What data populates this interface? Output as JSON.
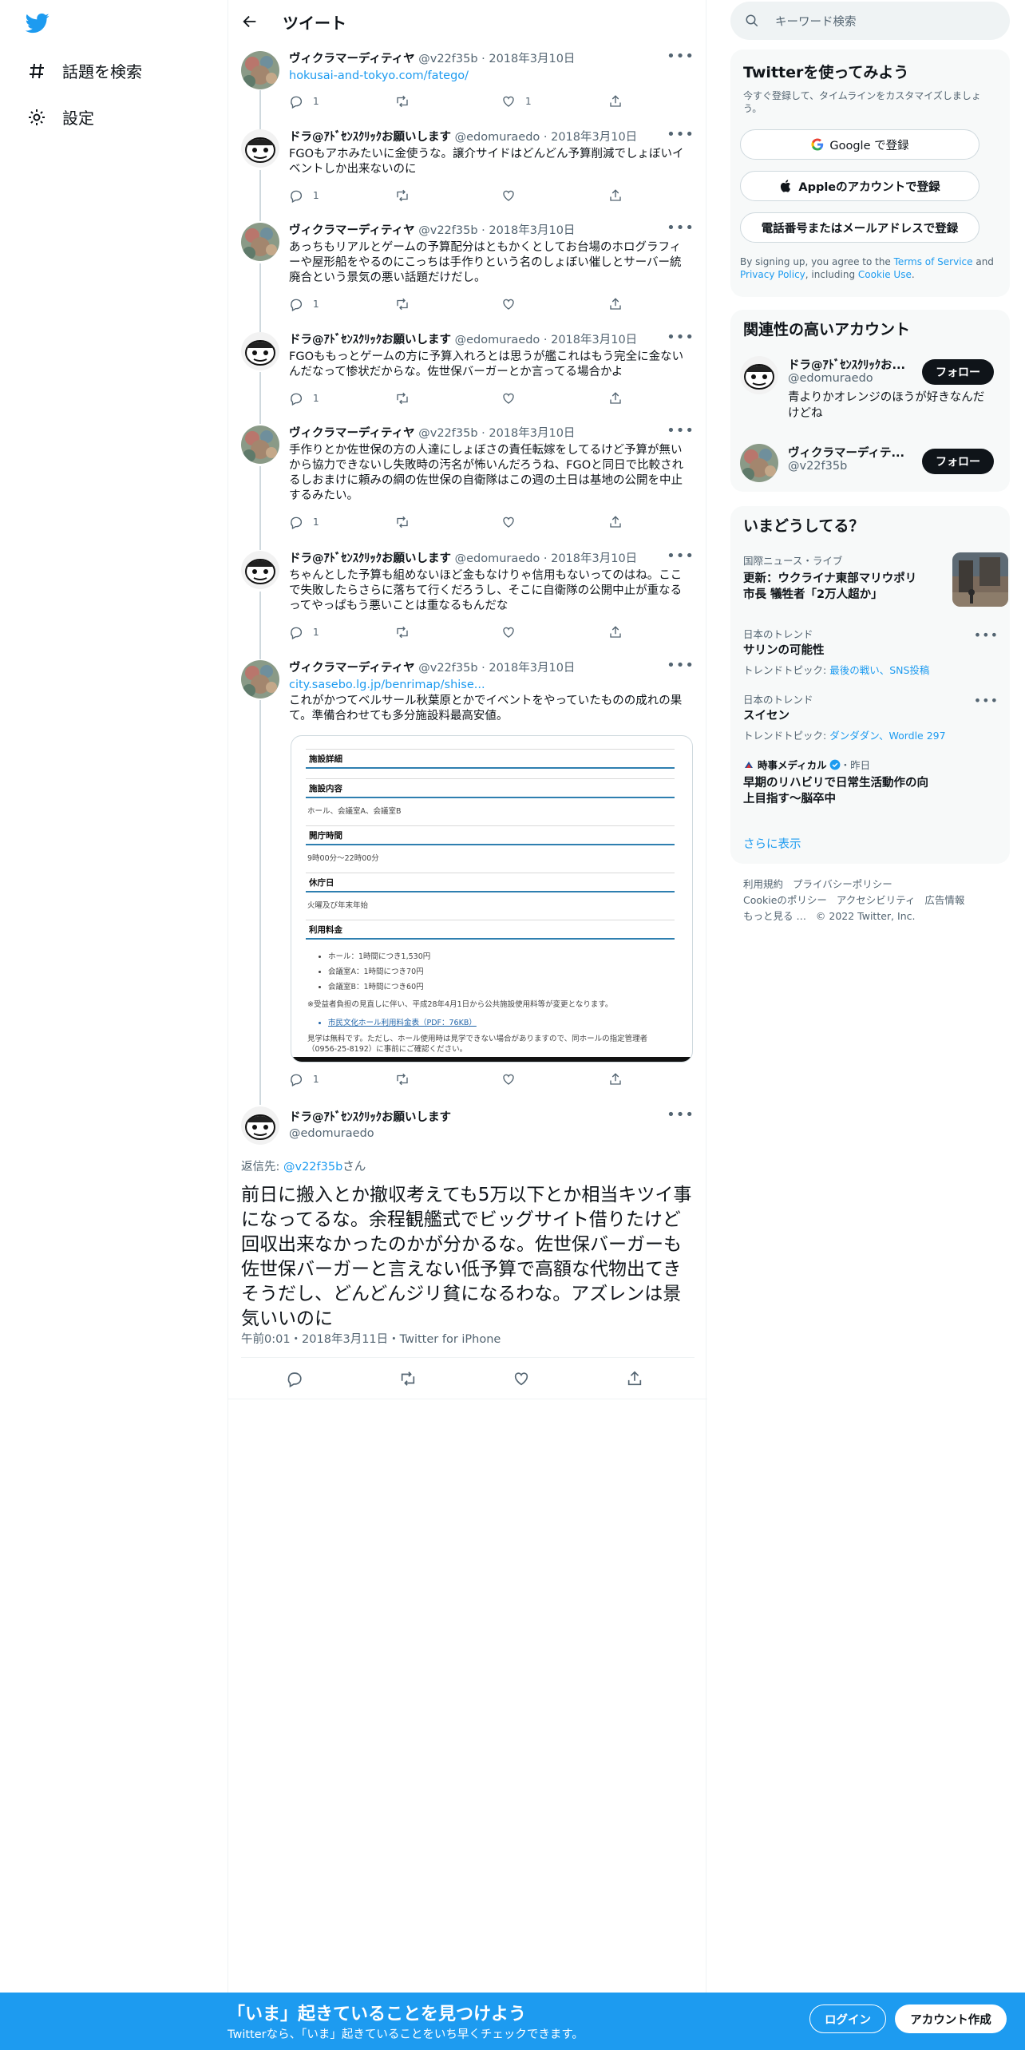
{
  "nav": {
    "explore": "話題を検索",
    "settings": "設定"
  },
  "header": {
    "title": "ツイート"
  },
  "tweets": [
    {
      "name": "ヴィクラマーディティヤ",
      "handle": "@v22f35b",
      "date": "2018年3月10日",
      "link": "hokusai-and-tokyo.com/fatego/",
      "text": "",
      "reply": "1",
      "retweet": "",
      "like": "1"
    },
    {
      "name": "ドラ@ｱﾄﾞｾﾝｽｸﾘｯｸお願いします",
      "handle": "@edomuraedo",
      "date": "2018年3月10日",
      "text": "FGOもアホみたいに金使うな。譲介サイドはどんどん予算削減でしょぼいイベントしか出来ないのに",
      "reply": "1",
      "retweet": "",
      "like": ""
    },
    {
      "name": "ヴィクラマーディティヤ",
      "handle": "@v22f35b",
      "date": "2018年3月10日",
      "text": "あっちもリアルとゲームの予算配分はともかくとしてお台場のホログラフィーや屋形船をやるのにこっちは手作りという名のしょぼい催しとサーバー統廃合という景気の悪い話題だけだし。",
      "reply": "1",
      "retweet": "",
      "like": ""
    },
    {
      "name": "ドラ@ｱﾄﾞｾﾝｽｸﾘｯｸお願いします",
      "handle": "@edomuraedo",
      "date": "2018年3月10日",
      "text": "FGOももっとゲームの方に予算入れろとは思うが艦これはもう完全に金ないんだなって惨状だからな。佐世保バーガーとか言ってる場合かよ",
      "reply": "1",
      "retweet": "",
      "like": ""
    },
    {
      "name": "ヴィクラマーディティヤ",
      "handle": "@v22f35b",
      "date": "2018年3月10日",
      "text": "手作りとか佐世保の方の人達にしょぼさの責任転嫁をしてるけど予算が無いから協力できないし失敗時の汚名が怖いんだろうね、FGOと同日で比較されるしおまけに頼みの綱の佐世保の自衛隊はこの週の土日は基地の公開を中止するみたい。",
      "reply": "1",
      "retweet": "",
      "like": ""
    },
    {
      "name": "ドラ@ｱﾄﾞｾﾝｽｸﾘｯｸお願いします",
      "handle": "@edomuraedo",
      "date": "2018年3月10日",
      "text": "ちゃんとした予算も組めないほど金もなけりゃ信用もないってのはね。ここで失敗したらさらに落ちて行くだろうし、そこに自衛隊の公開中止が重なるってやっぱもう悪いことは重なるもんだな",
      "reply": "1",
      "retweet": "",
      "like": ""
    },
    {
      "name": "ヴィクラマーディティヤ",
      "handle": "@v22f35b",
      "date": "2018年3月10日",
      "link": "city.sasebo.lg.jp/benrimap/shise...",
      "text": "これがかつてベルサール秋葉原とかでイベントをやっていたものの成れの果て。準備合わせても多分施設料最高安値。",
      "reply": "1",
      "retweet": "",
      "like": ""
    }
  ],
  "facility": {
    "heading": "施設詳細",
    "sections": [
      {
        "title": "施設内容",
        "body": "ホール、会議室A、会議室B"
      },
      {
        "title": "開庁時間",
        "body": "9時00分〜22時00分"
      },
      {
        "title": "休庁日",
        "body": "火曜及び年末年始"
      },
      {
        "title": "利用料金",
        "items": [
          "ホール：1時間につき1,530円",
          "会議室A：1時間につき70円",
          "会議室B：1時間につき60円"
        ]
      }
    ],
    "note": "※受益者負担の見直しに伴い、平成28年4月1日から公共施設使用料等が変更となります。",
    "pdf": "市民文化ホール利用料金表（PDF：76KB）",
    "footer": "見学は無料です。ただし、ホール使用時は見学できない場合がありますので、同ホールの指定管理者（0956-25-8192）に事前にご確認ください。"
  },
  "main_tweet": {
    "name": "ドラ@ｱﾄﾞｾﾝｽｸﾘｯｸお願いします",
    "handle": "@edomuraedo",
    "reply_prefix": "返信先: ",
    "reply_to": "@v22f35b",
    "reply_suffix": "さん",
    "text": "前日に搬入とか撤収考えても5万以下とか相当キツイ事になってるな。余程観艦式でビッグサイト借りたけど回収出来なかったのかが分かるな。佐世保バーガーも佐世保バーガーと言えない低予算で高額な代物出てきそうだし、どんどんジリ貧になるわな。アズレンは景気いいのに",
    "timestamp": "午前0:01・2018年3月11日・Twitter for iPhone"
  },
  "sidebar": {
    "search_placeholder": "キーワード検索",
    "signup": {
      "title": "Twitterを使ってみよう",
      "subtitle": "今すぐ登録して、タイムラインをカスタマイズしましょう。",
      "google": "Google で登録",
      "apple": "Appleのアカウントで登録",
      "phone": "電話番号またはメールアドレスで登録",
      "terms_pre": "By signing up, you agree to the ",
      "terms_link": "Terms of Service",
      "terms_mid": " and ",
      "privacy_link": "Privacy Policy",
      "terms_mid2": ", including ",
      "cookie_link": "Cookie Use",
      "terms_end": "."
    },
    "relevant": {
      "title": "関連性の高いアカウント",
      "accounts": [
        {
          "name": "ドラ@ｱﾄﾞｾﾝｽｸﾘｯｸお...",
          "handle": "@edomuraedo",
          "bio": "青よりかオレンジのほうが好きなんだけどね",
          "follow": "フォロー"
        },
        {
          "name": "ヴィクラマーディテ...",
          "handle": "@v22f35b",
          "bio": "",
          "follow": "フォロー"
        }
      ]
    },
    "trends": {
      "title": "いまどうしてる？",
      "items": [
        {
          "category": "国際ニュース・ライブ",
          "title": "更新：ウクライナ東部マリウポリ市長 犠牲者「2万人超か」"
        },
        {
          "category": "日本のトレンド",
          "title": "サリンの可能性",
          "topic_label": "トレンドトピック: ",
          "topics": "最後の戦い、SNS投稿"
        },
        {
          "category": "日本のトレンド",
          "title": "スイセン",
          "topic_label": "トレンドトピック: ",
          "topics": "ダンダダン、Wordle 297"
        },
        {
          "source": "時事メディカル",
          "time": "・昨日",
          "title": "早期のリハビリで日常生活動作の向上目指す～脳卒中"
        }
      ],
      "more": "さらに表示"
    },
    "footer": [
      "利用規約",
      "プライバシーポリシー",
      "Cookieのポリシー",
      "アクセシビリティ",
      "広告情報",
      "もっと見る …",
      "© 2022 Twitter, Inc."
    ]
  },
  "bottom": {
    "title": "「いま」起きていることを見つけよう",
    "subtitle": "Twitterなら、「いま」起きていることをいち早くチェックできます。",
    "login": "ログイン",
    "signup": "アカウント作成"
  },
  "colors": {
    "brand": "#1d9bf0",
    "text": "#0f1419",
    "muted": "#536471"
  }
}
